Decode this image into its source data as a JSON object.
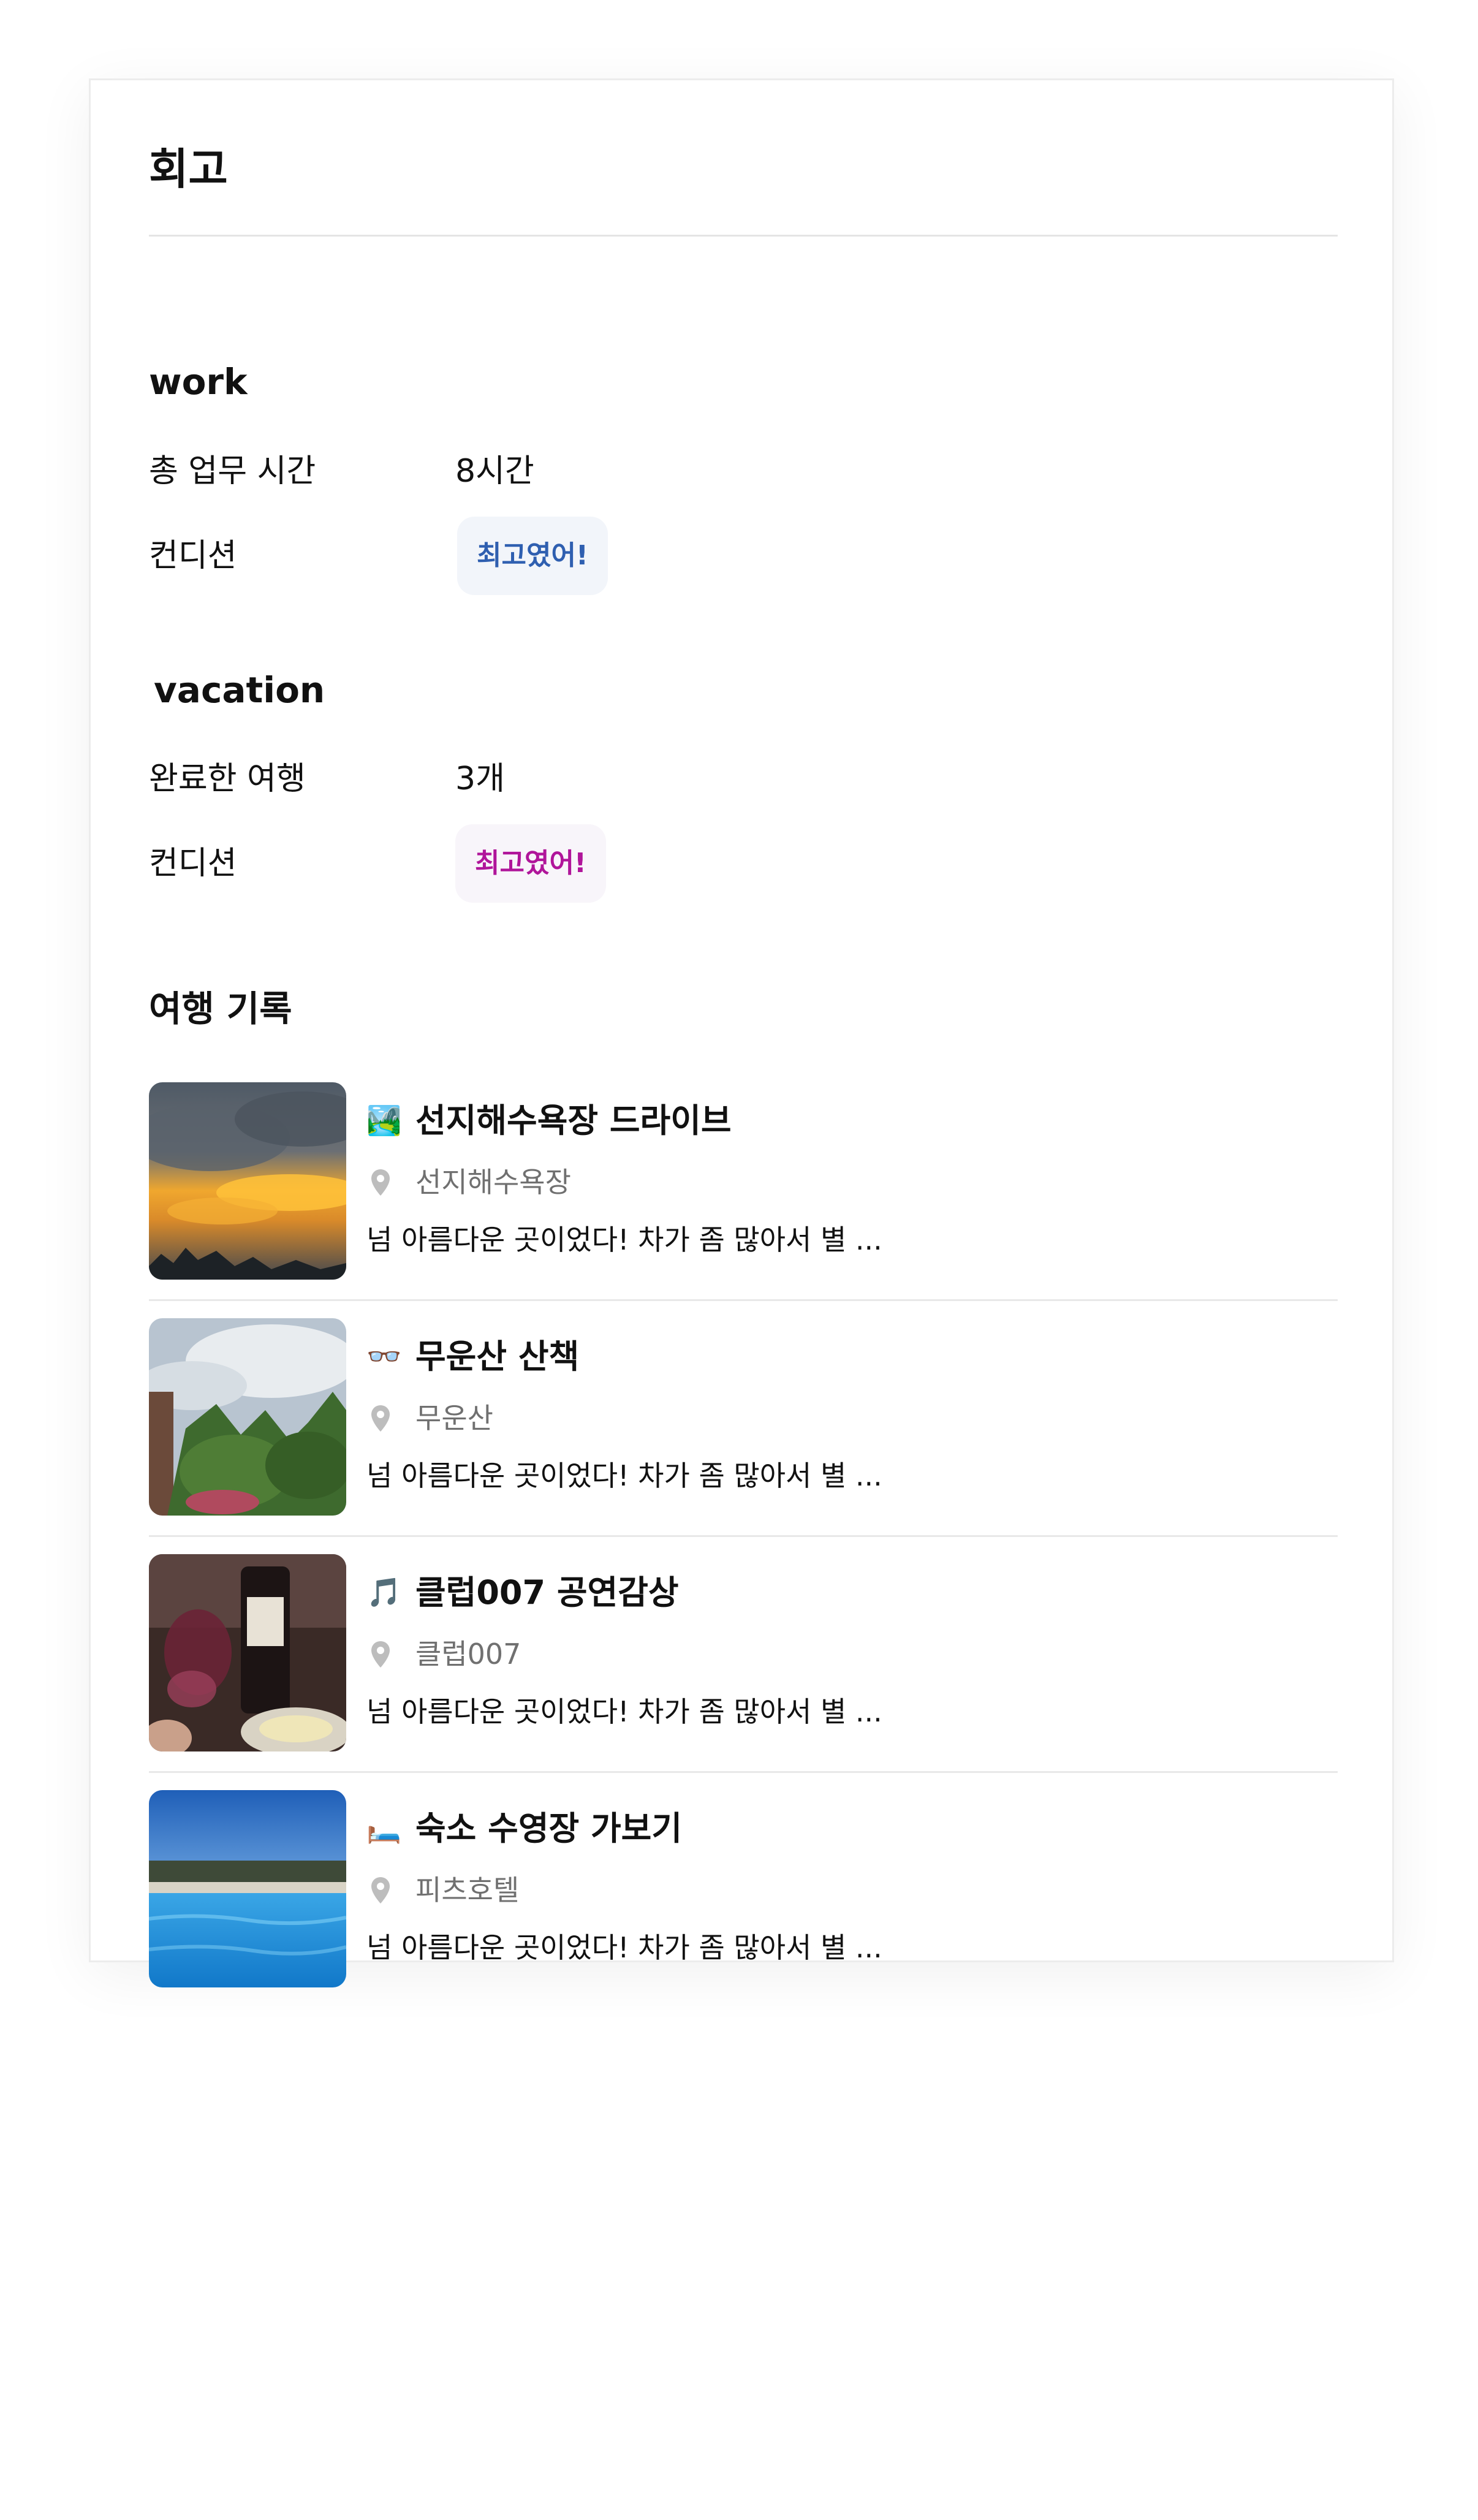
{
  "page": {
    "title": "회고"
  },
  "work": {
    "heading": "work",
    "rows": [
      {
        "label": "총 업무 시간",
        "value": "8시간"
      },
      {
        "label": "컨디션",
        "badge": "최고였어!"
      }
    ]
  },
  "vacation": {
    "heading": "vacation",
    "rows": [
      {
        "label": "완료한 여행",
        "value": "3개"
      },
      {
        "label": "컨디션",
        "badge": "최고였어!"
      }
    ]
  },
  "travel": {
    "heading": "여행 기록",
    "items": [
      {
        "emoji": "🏞️",
        "title": "선지해수욕장 드라이브",
        "location": "선지해수욕장",
        "desc": "넘 아름다운 곳이었다! 차가 좀 많아서 별 ..."
      },
      {
        "emoji": "👓",
        "title": "무운산 산책",
        "location": "무운산",
        "desc": "넘 아름다운 곳이었다! 차가 좀 많아서 별 ..."
      },
      {
        "emoji": "🎵",
        "title": "클럽007 공연감상",
        "location": "클럽007",
        "desc": "넘 아름다운 곳이었다! 차가 좀 많아서 별 ..."
      },
      {
        "emoji": "🛏️",
        "title": "숙소 수영장 가보기",
        "location": "피츠호텔",
        "desc": "넘 아름다운 곳이었다! 차가 좀 많아서 별 ..."
      }
    ]
  },
  "colors": {
    "work_badge_text": "#2f5fb0",
    "work_badge_bg": "#f2f5fa",
    "vacation_badge_text": "#b0159a",
    "vacation_badge_bg": "#f8f5fa"
  },
  "icons": {
    "location": "map-pin-icon"
  }
}
